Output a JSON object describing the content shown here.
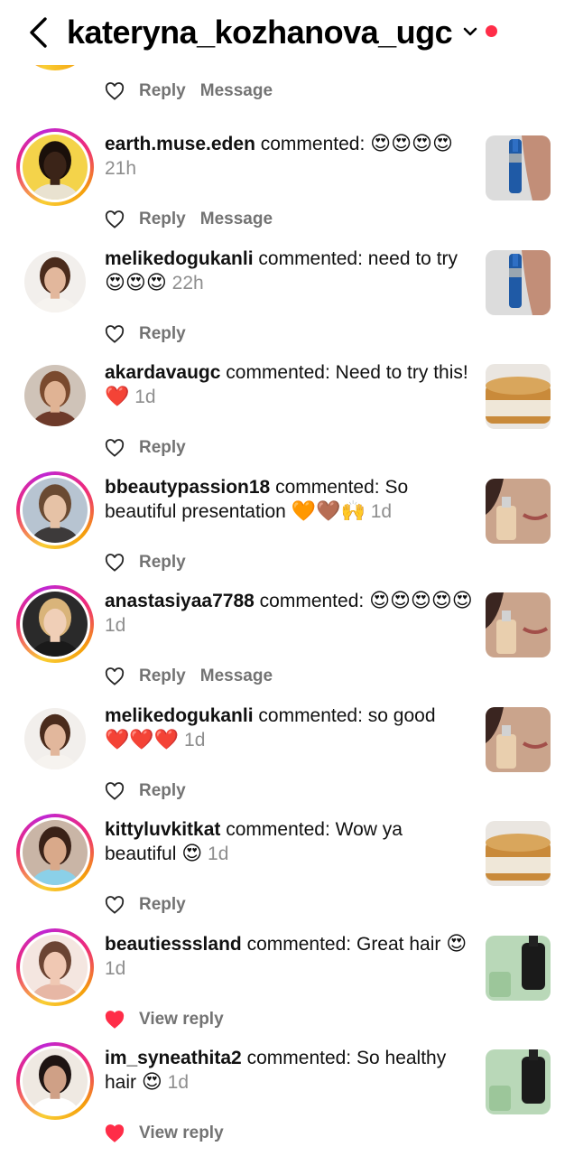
{
  "header": {
    "title": "kateryna_kozhanova_ugc",
    "back_icon": "chevron-left-icon",
    "dropdown_icon": "chevron-down-icon",
    "notification_color": "#ff2d48"
  },
  "labels": {
    "reply": "Reply",
    "message": "Message",
    "view_reply": "View reply"
  },
  "top_partial": {
    "reply": "Reply",
    "message": "Message"
  },
  "notifications": [
    {
      "username": "earth.muse.eden",
      "commented": "commented:",
      "text": "",
      "emojis": "😍😍😍😍",
      "time": "21h",
      "actions": [
        "Reply",
        "Message"
      ],
      "liked": false,
      "thumb": "blue-product"
    },
    {
      "username": "melikedogukanli",
      "commented": "commented:",
      "text": "need to try",
      "emojis": "😍😍😍",
      "time": "22h",
      "actions": [
        "Reply"
      ],
      "liked": false,
      "thumb": "blue-product"
    },
    {
      "username": "akardavaugc",
      "commented": "commented:",
      "text": "Need to try this!",
      "emojis": "❤️",
      "time": "1d",
      "actions": [
        "Reply"
      ],
      "liked": false,
      "thumb": "cream-jar"
    },
    {
      "username": "bbeautypassion18",
      "commented": "commented:",
      "text": "So beautiful presentation",
      "emojis": "🧡🤎🙌",
      "time": "1d",
      "actions": [
        "Reply"
      ],
      "liked": false,
      "thumb": "foundation-face"
    },
    {
      "username": "anastasiyaa7788",
      "commented": "commented:",
      "text": "",
      "emojis": "😍😍😍😍😍",
      "time": "1d",
      "actions": [
        "Reply",
        "Message"
      ],
      "liked": false,
      "thumb": "foundation-face"
    },
    {
      "username": "melikedogukanli",
      "commented": "commented:",
      "text": "so good",
      "emojis": "❤️❤️❤️",
      "time": "1d",
      "actions": [
        "Reply"
      ],
      "liked": false,
      "thumb": "foundation-face"
    },
    {
      "username": "kittyluvkitkat",
      "commented": "commented:",
      "text": "Wow ya beautiful",
      "emojis": "😍",
      "time": "1d",
      "actions": [
        "Reply"
      ],
      "liked": false,
      "thumb": "cream-jar"
    },
    {
      "username": "beautiesssland",
      "commented": "commented:",
      "text": "Great hair",
      "emojis": "😍",
      "time": "1d",
      "actions": [
        "View reply"
      ],
      "liked": true,
      "thumb": "green-bottle"
    },
    {
      "username": "im_syneathita2",
      "commented": "commented:",
      "text": "So healthy hair",
      "emojis": "😍",
      "time": "1d",
      "actions": [
        "View reply"
      ],
      "liked": true,
      "thumb": "green-bottle"
    }
  ]
}
